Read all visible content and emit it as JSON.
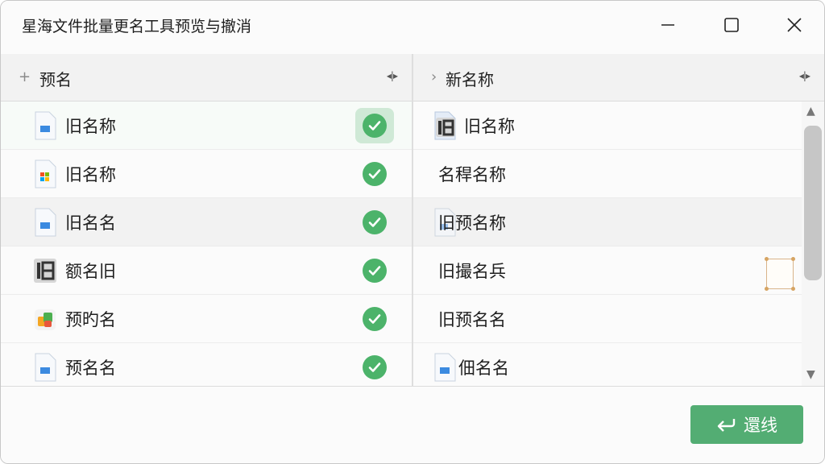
{
  "window": {
    "title": "星海文件批量更名工具预览与撤消"
  },
  "columns": {
    "left": {
      "prefix": "+",
      "label": "预名"
    },
    "right": {
      "prefix": "›",
      "label": "新名称"
    }
  },
  "rows": [
    {
      "old_name": "旧名称",
      "old_icon": "doc-blue-icon",
      "new_name": "旧名称",
      "new_icon": "old-glyph-icon",
      "status": "check-icon"
    },
    {
      "old_name": "旧名称",
      "old_icon": "windows-grid-icon",
      "new_name": "名稈名称",
      "new_icon": "",
      "status": "check-icon"
    },
    {
      "old_name": "旧名名",
      "old_icon": "doc-blue-icon",
      "new_name": "旧预名称",
      "new_icon": "doc-faded-icon",
      "status": "check-icon"
    },
    {
      "old_name": "额名旧",
      "old_icon": "old-glyph-icon",
      "new_name": "旧撮名兵",
      "new_icon": "",
      "status": "check-icon"
    },
    {
      "old_name": "预旳名",
      "old_icon": "colorful-app-icon",
      "new_name": "旧预名名",
      "new_icon": "",
      "status": "check-icon"
    },
    {
      "old_name": "预名名",
      "old_icon": "doc-blue-icon",
      "new_name": "佃名名",
      "new_icon": "doc-blue-icon",
      "status": "check-icon"
    }
  ],
  "footer": {
    "restore_label": "還线",
    "restore_icon": "return-arrow-icon"
  },
  "colors": {
    "accent": "#53ad73",
    "check": "#4cb36a"
  }
}
